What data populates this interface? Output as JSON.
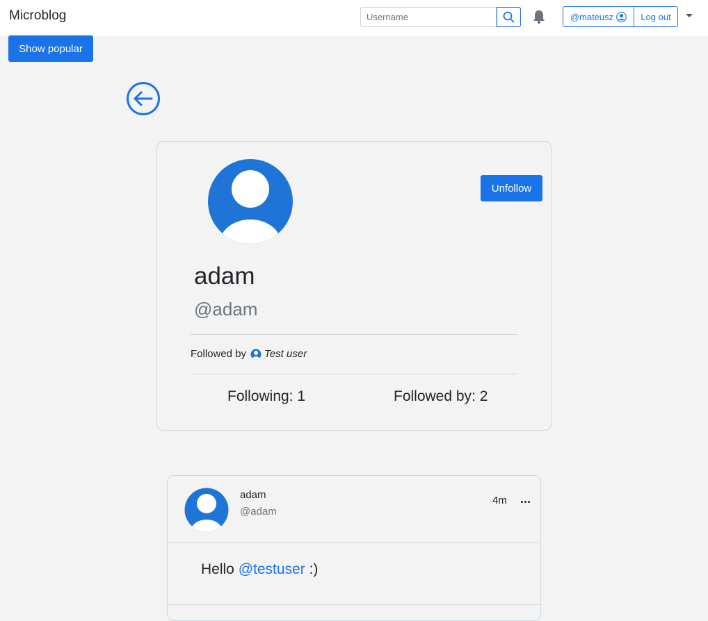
{
  "navbar": {
    "brand": "Microblog",
    "search_placeholder": "Username",
    "user_label": "@mateusz",
    "logout_label": "Log out"
  },
  "toolbar": {
    "popular_label": "Show popular"
  },
  "profile": {
    "name": "adam",
    "handle": "@adam",
    "action_label": "Unfollow",
    "followed_by_prefix": "Followed by",
    "followed_by_user": "Test user",
    "following_label": "Following: 1",
    "followers_label": "Followed by: 2"
  },
  "post": {
    "author_name": "adam",
    "author_handle": "@adam",
    "time": "4m",
    "text_before": "Hello ",
    "mention": "@testuser",
    "text_after": " :)"
  },
  "colors": {
    "accent": "#1a73e8",
    "background": "#f3f3f3"
  },
  "icons": [
    "search-icon",
    "bell-icon",
    "user-circle-icon",
    "dropdown-caret-icon",
    "back-arrow-icon",
    "avatar-icon",
    "more-options-icon"
  ]
}
